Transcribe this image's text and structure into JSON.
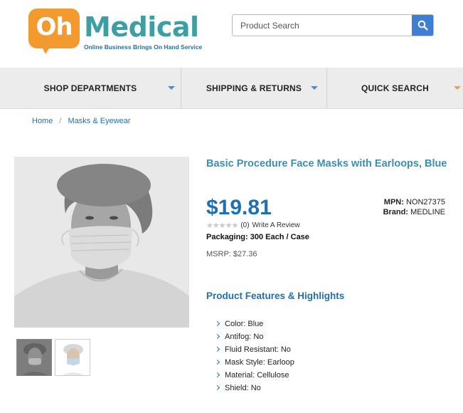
{
  "brand": {
    "badge_text": "Oh",
    "name": "Medical",
    "tagline": "Online Business Brings On Hand Service",
    "badge_color": "#f29a2e",
    "name_color": "#3d9ea4"
  },
  "search": {
    "placeholder": "Product Search",
    "button_icon": "search-icon"
  },
  "nav": {
    "items": [
      {
        "label": "SHOP DEPARTMENTS",
        "icon": "caret-down-icon"
      },
      {
        "label": "SHIPPING & RETURNS",
        "icon": "caret-down-icon"
      },
      {
        "label": "QUICK SEARCH",
        "icon": "caret-down-icon"
      }
    ]
  },
  "breadcrumb": {
    "items": [
      "Home",
      "Masks & Eyewear"
    ],
    "separator": "/"
  },
  "product": {
    "title": "Basic Procedure Face Masks with Earloops, Blue",
    "price": "$19.81",
    "mpn_label": "MPN:",
    "mpn": "NON27375",
    "brand_label": "Brand:",
    "brand": "MEDLINE",
    "rating_count": "(0)",
    "review_link": "Write A Review",
    "packaging_label": "Packaging:",
    "packaging": "300 Each / Case",
    "msrp": "MSRP: $27.36",
    "thumbnails": 2
  },
  "features": {
    "heading": "Product Features & Highlights",
    "items": [
      "Color: Blue",
      "Antifog: No",
      "Fluid Resistant: No",
      "Mask Style: Earloop",
      "Material: Cellulose",
      "Shield: No"
    ]
  },
  "colors": {
    "link_blue": "#1f6fb4",
    "title_teal": "#3a8fb3",
    "nav_bg": "#ececec",
    "search_button": "#3d7fd2",
    "caret_blue": "#3d8fd6",
    "caret_orange": "#f0a040"
  }
}
